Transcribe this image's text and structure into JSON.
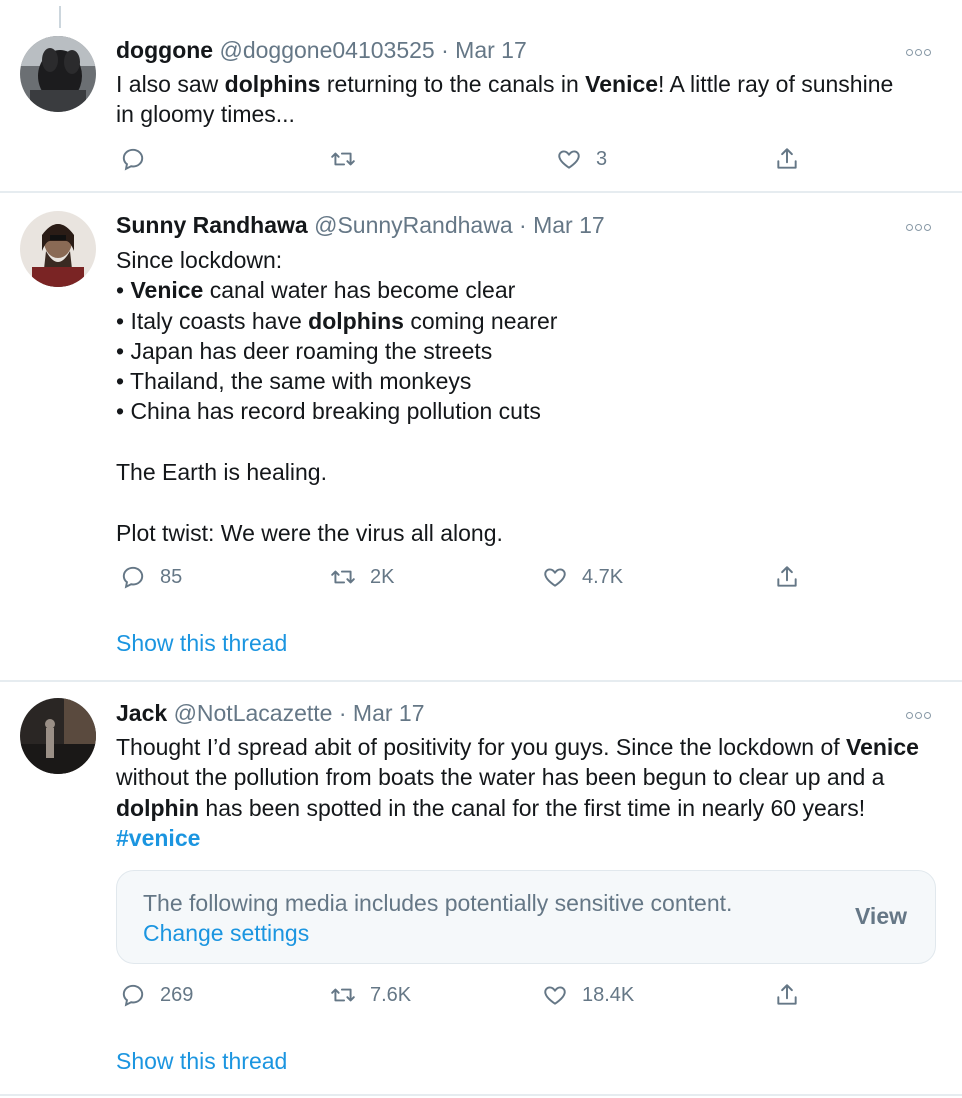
{
  "tweets": [
    {
      "name": "doggone",
      "handle": "@doggone04103525",
      "date": "Mar 17",
      "segments": [
        {
          "t": "I also saw "
        },
        {
          "t": "dolphins",
          "b": true
        },
        {
          "t": " returning to the canals in "
        },
        {
          "t": "Venice",
          "b": true
        },
        {
          "t": "! A little ray of sunshine in gloomy times..."
        }
      ],
      "replies": "",
      "retweets": "",
      "likes": "3",
      "show_thread": ""
    },
    {
      "name": "Sunny Randhawa",
      "handle": "@SunnyRandhawa",
      "date": "Mar 17",
      "lines": [
        [
          {
            "t": "Since lockdown:"
          }
        ],
        [
          {
            "t": "• "
          },
          {
            "t": "Venice",
            "b": true
          },
          {
            "t": " canal water has become clear"
          }
        ],
        [
          {
            "t": "• Italy coasts have "
          },
          {
            "t": "dolphins",
            "b": true
          },
          {
            "t": " coming nearer"
          }
        ],
        [
          {
            "t": "• Japan has deer roaming the streets"
          }
        ],
        [
          {
            "t": "• Thailand, the same with monkeys"
          }
        ],
        [
          {
            "t": "• China has record breaking pollution cuts"
          }
        ],
        [
          {
            "t": ""
          }
        ],
        [
          {
            "t": "The Earth is healing."
          }
        ],
        [
          {
            "t": ""
          }
        ],
        [
          {
            "t": "Plot twist: We were the virus all along."
          }
        ]
      ],
      "replies": "85",
      "retweets": "2K",
      "likes": "4.7K",
      "show_thread": "Show this thread"
    },
    {
      "name": "Jack",
      "handle": "@NotLacazette",
      "date": "Mar 17",
      "segments": [
        {
          "t": "Thought I’d spread abit of positivity for you guys. Since the lockdown of "
        },
        {
          "t": "Venice",
          "b": true
        },
        {
          "t": " without the pollution from boats the water has been begun to clear up and a "
        },
        {
          "t": "dolphin",
          "b": true
        },
        {
          "t": " has been spotted in the canal for the first time in nearly 60 years! "
        },
        {
          "t": "#venice",
          "tag": true
        }
      ],
      "sensitive": {
        "message": "The following media includes potentially sensitive content.",
        "change_settings": "Change settings",
        "view": "View"
      },
      "replies": "269",
      "retweets": "7.6K",
      "likes": "18.4K",
      "show_thread": "Show this thread"
    }
  ],
  "separator": "·",
  "colors": {
    "link": "#1b95e0",
    "muted": "#657786",
    "divider": "#e6ecf0"
  },
  "icons": [
    "reply-icon",
    "retweet-icon",
    "like-icon",
    "share-icon",
    "more-icon"
  ]
}
